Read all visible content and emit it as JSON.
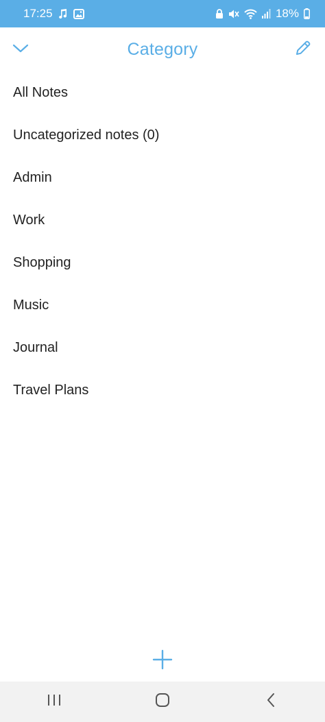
{
  "status_bar": {
    "time": "17:25",
    "battery": "18%",
    "background": "#5aaee6",
    "left_icons": [
      "music-note-icon",
      "image-icon"
    ],
    "right_icons": [
      "lock-icon",
      "mute-icon",
      "wifi-icon",
      "signal-icon",
      "battery-icon"
    ]
  },
  "header": {
    "title": "Category",
    "accent": "#5aaee6",
    "left_icon": "chevron-down-icon",
    "right_icon": "pencil-icon"
  },
  "categories": [
    {
      "label": "All Notes"
    },
    {
      "label": "Uncategorized notes (0)"
    },
    {
      "label": "Admin"
    },
    {
      "label": "Work"
    },
    {
      "label": "Shopping"
    },
    {
      "label": "Music"
    },
    {
      "label": "Journal"
    },
    {
      "label": "Travel Plans"
    }
  ],
  "add_button": {
    "icon": "plus-icon"
  },
  "nav_bar": {
    "icons": [
      "recent-apps-icon",
      "home-icon",
      "back-icon"
    ]
  }
}
